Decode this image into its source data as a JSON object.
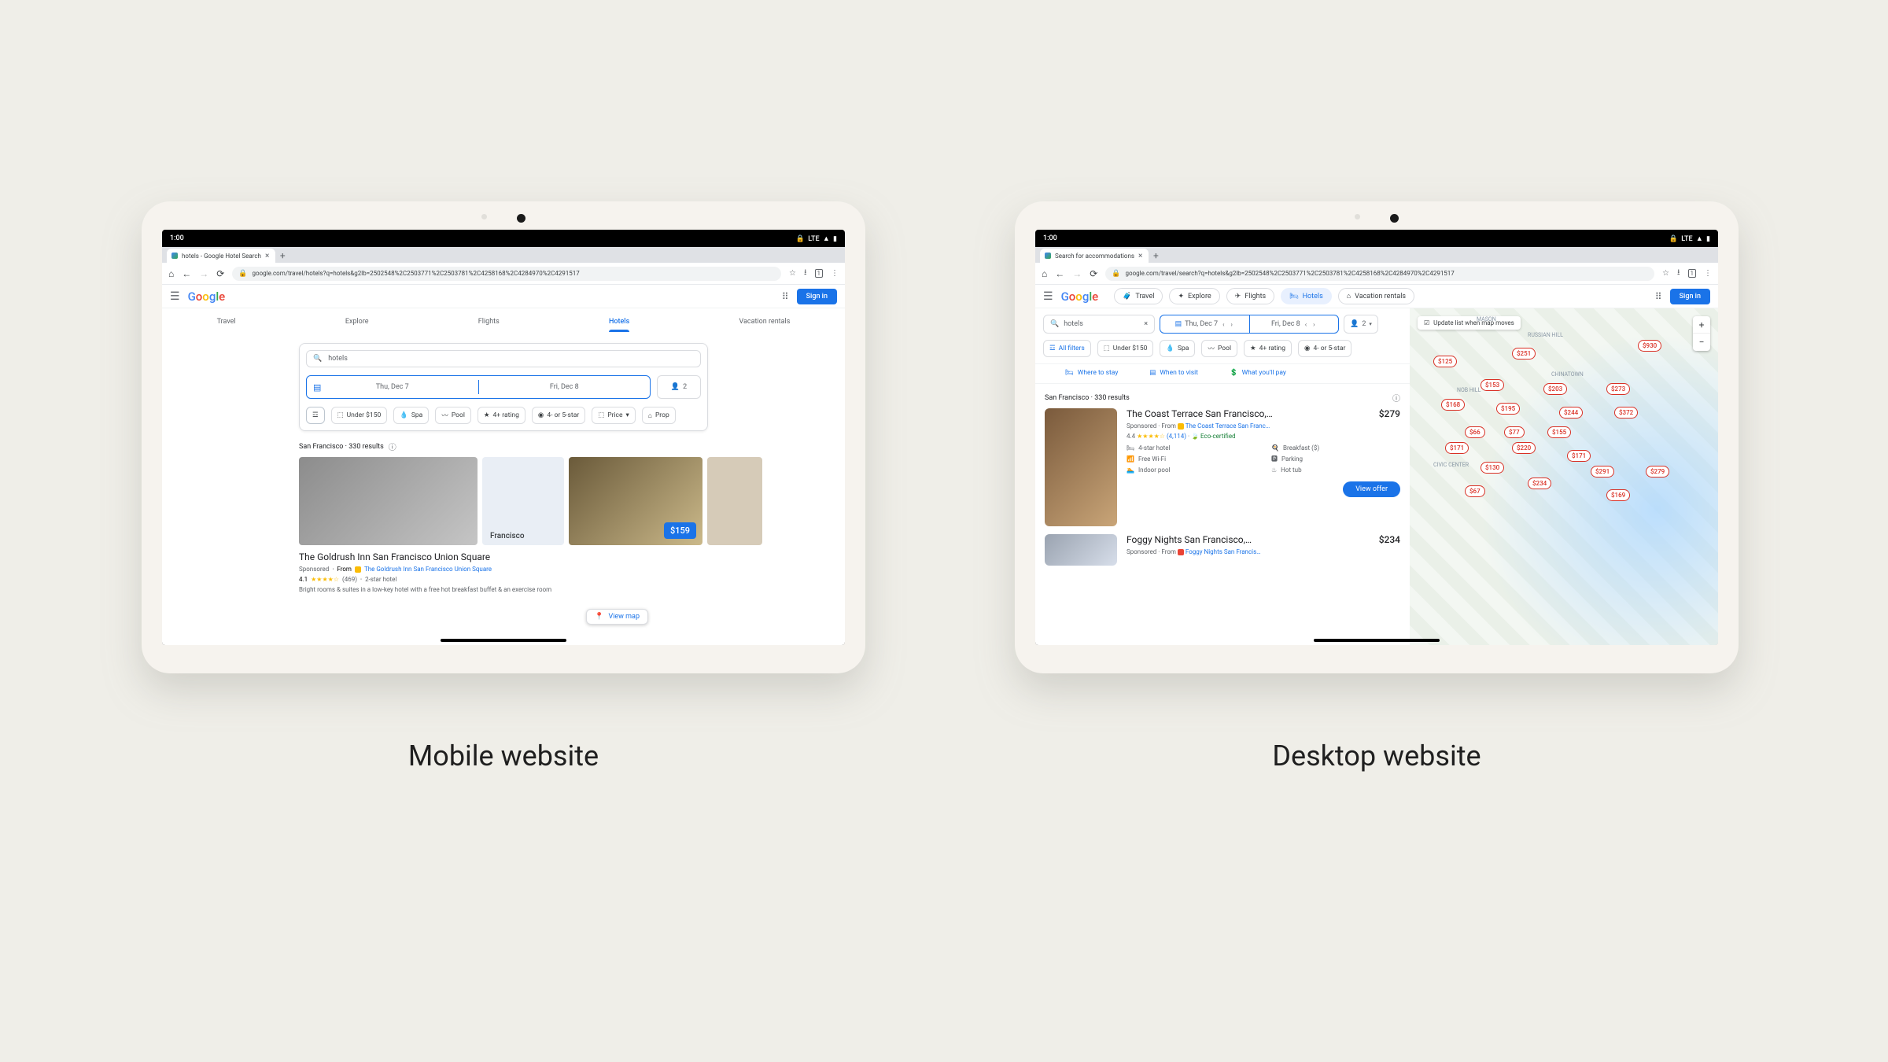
{
  "captions": {
    "mobile": "Mobile website",
    "desktop": "Desktop website"
  },
  "status": {
    "time": "1:00",
    "network": "LTE",
    "vpn_icon": "🔒",
    "signal_icon": "▲",
    "battery_icon": "▮"
  },
  "mobile": {
    "tab_title": "hotels - Google Hotel Search",
    "url": "google.com/travel/hotels?q=hotels&g2lb=2502548%2C2503771%2C2503781%2C4258168%2C4284970%2C4291517",
    "sign_in": "Sign in",
    "nav": [
      "Travel",
      "Explore",
      "Flights",
      "Hotels",
      "Vacation rentals"
    ],
    "nav_active": "Hotels",
    "search_placeholder": "hotels",
    "dates": {
      "checkin": "Thu, Dec 7",
      "checkout": "Fri, Dec 8"
    },
    "guests": "2",
    "filters": [
      "Under $150",
      "Spa",
      "Pool",
      "4+ rating",
      "4- or 5-star",
      "Price"
    ],
    "results_header": "San Francisco · 330 results",
    "map_label": "Francisco",
    "price_badge": "$159",
    "hotel_name": "The Goldrush Inn San Francisco Union Square",
    "sponsored": "Sponsored",
    "from": "From",
    "from_text": "The Goldrush Inn San Francisco Union Square",
    "rating_value": "4.1",
    "reviews_count": "(469)",
    "stars_text": "2-star hotel",
    "description": "Bright rooms & suites in a low-key hotel with a free hot breakfast buffet & an exercise room",
    "view_map": "View map"
  },
  "desktop": {
    "tab_title": "Search for accommodations",
    "url": "google.com/travel/search?q=hotels&g2lb=2502548%2C2503771%2C2503781%2C4258168%2C4284970%2C4291517",
    "sign_in": "Sign in",
    "chips": [
      "Travel",
      "Explore",
      "Flights",
      "Hotels",
      "Vacation rentals"
    ],
    "chip_active": "Hotels",
    "search_value": "hotels",
    "dates": {
      "checkin": "Thu, Dec 7",
      "checkout": "Fri, Dec 8"
    },
    "guests": "2",
    "all_filters": "All filters",
    "filters": [
      "Under $150",
      "Spa",
      "Pool",
      "4+ rating",
      "4- or 5-star"
    ],
    "quick_links": [
      "Where to stay",
      "When to visit",
      "What you'll pay"
    ],
    "results_header": "San Francisco · 330 results",
    "map_update": "Update list when map moves",
    "card1": {
      "name": "The Coast Terrace San Francisco,…",
      "price": "$279",
      "sponsored": "Sponsored",
      "from": "From",
      "from_text": "The Coast Terrace San Franc…",
      "rating_value": "4.4",
      "reviews_count": "(4,114)",
      "eco": "Eco-certified",
      "stars_text": "4-star hotel",
      "amenities": [
        "Breakfast ($)",
        "Free Wi-Fi",
        "Parking",
        "Indoor pool",
        "Hot tub"
      ],
      "view_offer": "View offer"
    },
    "card2": {
      "name": "Foggy Nights San Francisco,…",
      "price": "$234",
      "sponsored": "Sponsored",
      "from": "From",
      "from_text": "Foggy Nights San Francis…"
    },
    "map_pins": [
      "$125",
      "$251",
      "$930",
      "$153",
      "$203",
      "$273",
      "$168",
      "$195",
      "$244",
      "$372",
      "$66",
      "$77",
      "$155",
      "$171",
      "$220",
      "$171",
      "$130",
      "$291",
      "$234",
      "$67",
      "$279",
      "$169"
    ],
    "map_districts": [
      "MASON",
      "RUSSIAN HILL",
      "NOB HILL",
      "CHINATOWN",
      "CIVIC CENTER"
    ]
  }
}
